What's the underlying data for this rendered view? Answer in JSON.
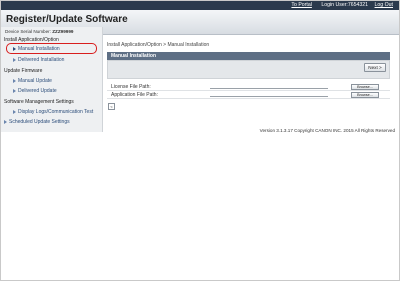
{
  "topbar": {
    "portal_link": "To Portal",
    "login_user": "Login User:7654321",
    "logout_link": "Log Out"
  },
  "header": {
    "title": "Register/Update Software"
  },
  "sidebar": {
    "serial_label": "Device Serial Number:",
    "serial_value": "ZZZ99999",
    "groups": [
      {
        "label": "Install Application/Option"
      },
      {
        "label": "Update Firmware"
      },
      {
        "label": "Software Management Settings"
      }
    ],
    "items": [
      {
        "label": "Manual Installation"
      },
      {
        "label": "Delivered Installation"
      },
      {
        "label": "Manual Update"
      },
      {
        "label": "Delivered Update"
      },
      {
        "label": "Display Logs/Communication Test"
      },
      {
        "label": "Scheduled Update Settings"
      }
    ]
  },
  "main": {
    "breadcrumb": "Install Application/Option > Manual Installation",
    "panel_title": "Manual Installation",
    "next_button": "Next >",
    "fields": [
      {
        "label": "License File Path:",
        "value": "",
        "button": "Browse..."
      },
      {
        "label": "Application File Path:",
        "value": "",
        "button": "Browse..."
      }
    ],
    "small_button": "<"
  },
  "footer": {
    "copyright": "Version 3.1.3.17 Copyright CANON INC. 2015 All Rights Reserved"
  },
  "colors": {
    "topbar": "#2b3a4d",
    "panel_title": "#5e6f85",
    "link": "#2c4d7a",
    "highlight": "#d81e1e"
  }
}
